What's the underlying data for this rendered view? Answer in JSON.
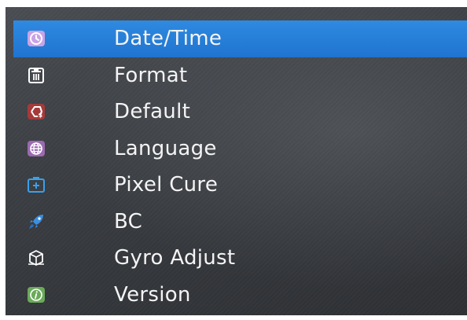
{
  "menu": {
    "selected_index": 0,
    "items": [
      {
        "label": "Date/Time",
        "icon": "clock-icon",
        "color": "#c9a3e6"
      },
      {
        "label": "Format",
        "icon": "trash-icon",
        "color": "#ffffff"
      },
      {
        "label": "Default",
        "icon": "reset-icon",
        "color": "#a63a3a"
      },
      {
        "label": "Language",
        "icon": "globe-icon",
        "color": "#9b6ab0"
      },
      {
        "label": "Pixel Cure",
        "icon": "pixel-cure-icon",
        "color": "#3aa0e8"
      },
      {
        "label": "BC",
        "icon": "rocket-icon",
        "color": "#3a8fe0"
      },
      {
        "label": "Gyro Adjust",
        "icon": "gyro-cube-icon",
        "color": "#ffffff"
      },
      {
        "label": "Version",
        "icon": "info-icon",
        "color": "#6aaa5a"
      }
    ]
  },
  "colors": {
    "selection": "#2a82da",
    "background": "#3c3f44",
    "text": "#f4f4f4"
  }
}
